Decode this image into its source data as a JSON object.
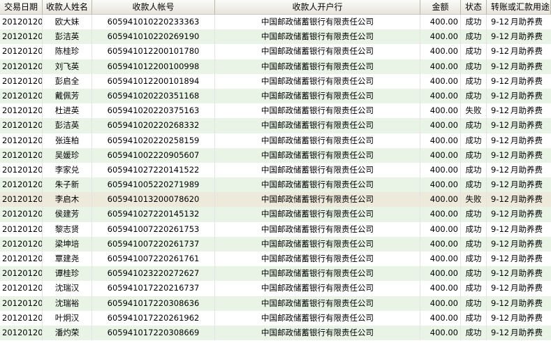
{
  "headers": [
    "交易日期",
    "收款人姓名",
    "收款人帐号",
    "收款人开户行",
    "金额",
    "状态",
    "转账或汇款用途"
  ],
  "rows": [
    {
      "date": "20120120",
      "name": "欧大妹",
      "account": "605941010220233363",
      "bank": "中国邮政储蓄银行有限责任公司",
      "amount": "400.00",
      "status": "成功",
      "code": "9-12",
      "purpose": "月助养费"
    },
    {
      "date": "20120120",
      "name": "彭洁英",
      "account": "605941010220269190",
      "bank": "中国邮政储蓄银行有限责任公司",
      "amount": "400.00",
      "status": "成功",
      "code": "9-12",
      "purpose": "月助养费"
    },
    {
      "date": "20120120",
      "name": "陈桂珍",
      "account": "605941012200101780",
      "bank": "中国邮政储蓄银行有限责任公司",
      "amount": "400.00",
      "status": "成功",
      "code": "9-12",
      "purpose": "月助养费"
    },
    {
      "date": "20120120",
      "name": "刘飞英",
      "account": "605941012200100998",
      "bank": "中国邮政储蓄银行有限责任公司",
      "amount": "400.00",
      "status": "成功",
      "code": "9-12",
      "purpose": "月助养费"
    },
    {
      "date": "20120120",
      "name": "彭启全",
      "account": "605941012200101894",
      "bank": "中国邮政储蓄银行有限责任公司",
      "amount": "400.00",
      "status": "成功",
      "code": "9-12",
      "purpose": "月助养费"
    },
    {
      "date": "20120120",
      "name": "戴佩芳",
      "account": "605941020220351168",
      "bank": "中国邮政储蓄银行有限责任公司",
      "amount": "400.00",
      "status": "成功",
      "code": "9-12",
      "purpose": "月助养费"
    },
    {
      "date": "20120120",
      "name": "杜进英",
      "account": "605941020220375163",
      "bank": "中国邮政储蓄银行有限责任公司",
      "amount": "400.00",
      "status": "失败",
      "code": "9-12",
      "purpose": "月助养费"
    },
    {
      "date": "20120120",
      "name": "彭洁英",
      "account": "605941020220268332",
      "bank": "中国邮政储蓄银行有限责任公司",
      "amount": "400.00",
      "status": "成功",
      "code": "9-12",
      "purpose": "月助养费"
    },
    {
      "date": "20120120",
      "name": "张连柏",
      "account": "605941020220258159",
      "bank": "中国邮政储蓄银行有限责任公司",
      "amount": "400.00",
      "status": "成功",
      "code": "9-12",
      "purpose": "月助养费"
    },
    {
      "date": "20120120",
      "name": "吴媛珍",
      "account": "605941002220905607",
      "bank": "中国邮政储蓄银行有限责任公司",
      "amount": "400.00",
      "status": "成功",
      "code": "9-12",
      "purpose": "月助养费"
    },
    {
      "date": "20120120",
      "name": "李家兑",
      "account": "605941027220141522",
      "bank": "中国邮政储蓄银行有限责任公司",
      "amount": "400.00",
      "status": "成功",
      "code": "9-12",
      "purpose": "月助养费"
    },
    {
      "date": "20120120",
      "name": "朱子新",
      "account": "605941005220271989",
      "bank": "中国邮政储蓄银行有限责任公司",
      "amount": "400.00",
      "status": "成功",
      "code": "9-12",
      "purpose": "月助养费"
    },
    {
      "date": "20120120",
      "name": "李启木",
      "account": "605941013200078620",
      "bank": "中国邮政储蓄银行有限责任公司",
      "amount": "400.00",
      "status": "失败",
      "code": "9-12",
      "purpose": "月助养费"
    },
    {
      "date": "20120120",
      "name": "侯建芳",
      "account": "605941027220145132",
      "bank": "中国邮政储蓄银行有限责任公司",
      "amount": "400.00",
      "status": "成功",
      "code": "9-12",
      "purpose": "月助养费"
    },
    {
      "date": "20120120",
      "name": "黎志贤",
      "account": "605941007220261753",
      "bank": "中国邮政储蓄银行有限责任公司",
      "amount": "400.00",
      "status": "成功",
      "code": "9-12",
      "purpose": "月助养费"
    },
    {
      "date": "20120120",
      "name": "梁坤培",
      "account": "605941007220261737",
      "bank": "中国邮政储蓄银行有限责任公司",
      "amount": "400.00",
      "status": "成功",
      "code": "9-12",
      "purpose": "月助养费"
    },
    {
      "date": "20120120",
      "name": "覃建尧",
      "account": "605941007220261761",
      "bank": "中国邮政储蓄银行有限责任公司",
      "amount": "400.00",
      "status": "成功",
      "code": "9-12",
      "purpose": "月助养费"
    },
    {
      "date": "20120120",
      "name": "谭桂珍",
      "account": "605941023220272627",
      "bank": "中国邮政储蓄银行有限责任公司",
      "amount": "400.00",
      "status": "成功",
      "code": "9-12",
      "purpose": "月助养费"
    },
    {
      "date": "20120120",
      "name": "沈瑞汉",
      "account": "605941017220216737",
      "bank": "中国邮政储蓄银行有限责任公司",
      "amount": "400.00",
      "status": "成功",
      "code": "9-12",
      "purpose": "月助养费"
    },
    {
      "date": "20120120",
      "name": "沈瑞裕",
      "account": "605941017220308636",
      "bank": "中国邮政储蓄银行有限责任公司",
      "amount": "400.00",
      "status": "成功",
      "code": "9-12",
      "purpose": "月助养费"
    },
    {
      "date": "20120120",
      "name": "叶炯汉",
      "account": "605941017220261962",
      "bank": "中国邮政储蓄银行有限责任公司",
      "amount": "400.00",
      "status": "成功",
      "code": "9-12",
      "purpose": "月助养费"
    },
    {
      "date": "20120120",
      "name": "潘灼荣",
      "account": "605941017220308669",
      "bank": "中国邮政储蓄银行有限责任公司",
      "amount": "400.00",
      "status": "成功",
      "code": "9-12",
      "purpose": "月助养费"
    }
  ],
  "selected_row": 12,
  "colors": {
    "alt_row": "#e9f4e6",
    "selected_row": "#ede9db",
    "header_bg": "#e6e4dc"
  }
}
